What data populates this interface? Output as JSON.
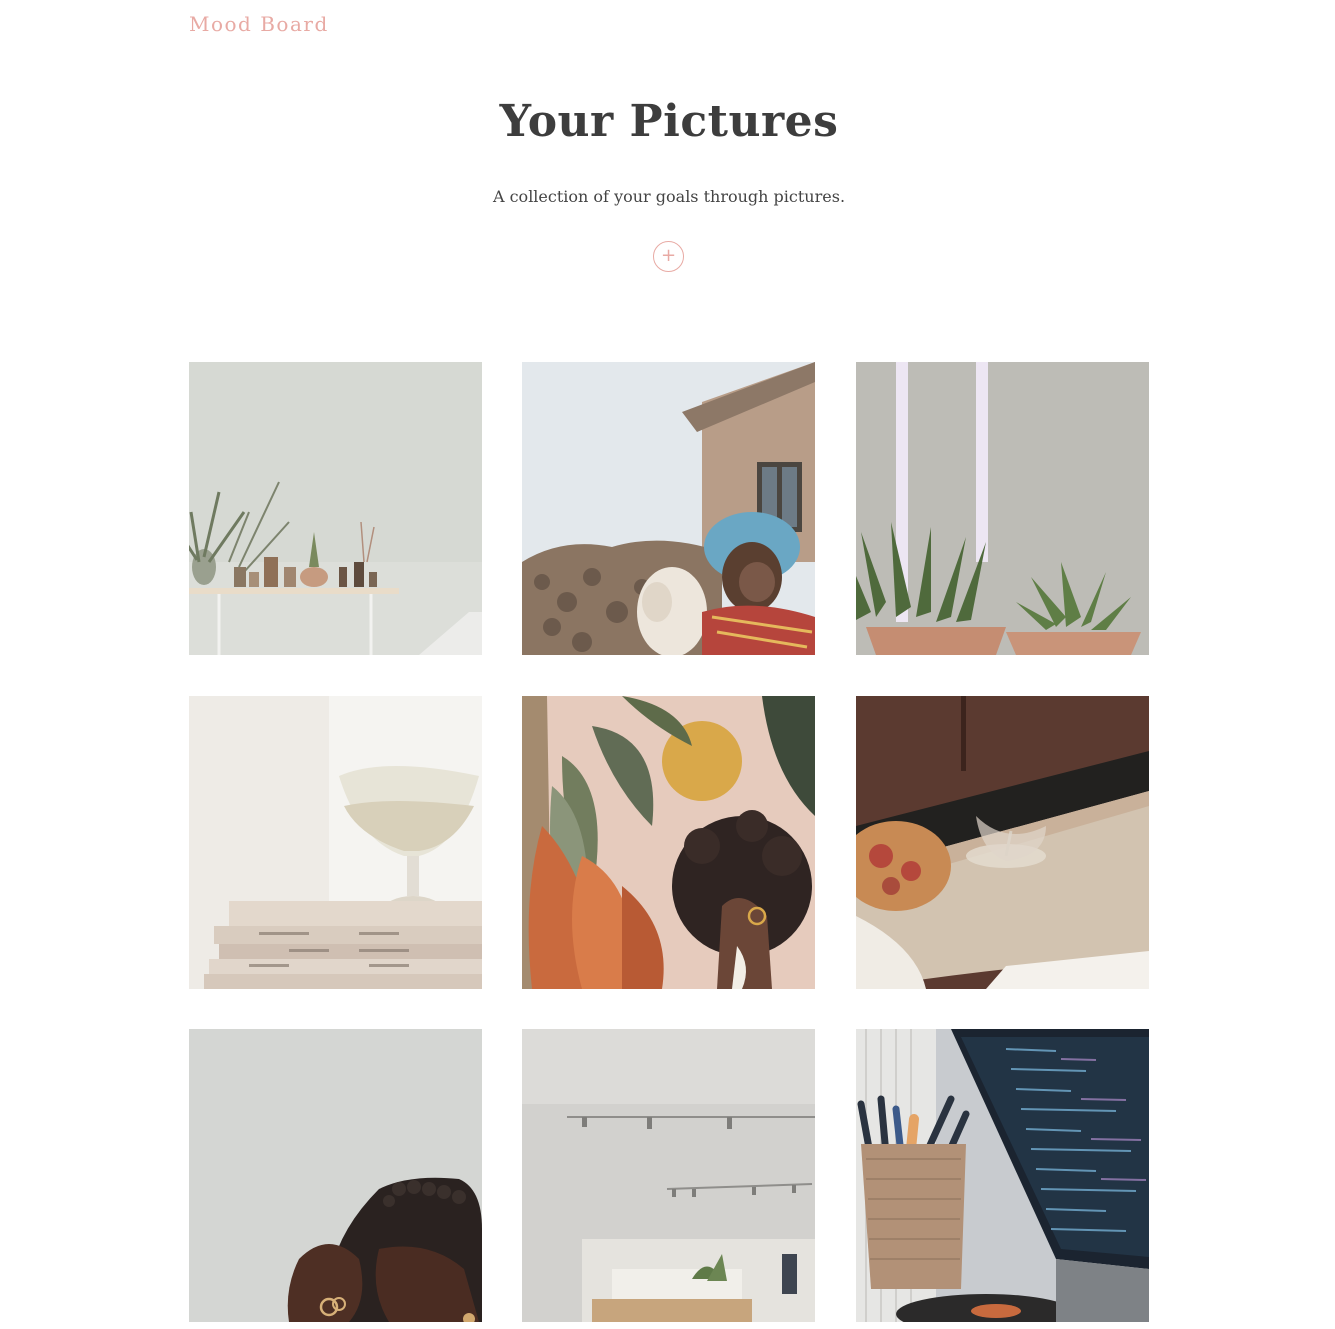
{
  "header": {
    "brand": "Mood Board"
  },
  "hero": {
    "title": "Your Pictures",
    "subtitle": "A collection of your goals through pictures.",
    "add_label": "+"
  },
  "gallery": {
    "tiles": [
      {
        "subject": "plants on wall shelf"
      },
      {
        "subject": "child with llama"
      },
      {
        "subject": "succulents with lights"
      },
      {
        "subject": "glass on stacked books"
      },
      {
        "subject": "illustrated woman with plants"
      },
      {
        "subject": "pizza and wine glass"
      },
      {
        "subject": "woman with braids"
      },
      {
        "subject": "minimal bedroom interior"
      },
      {
        "subject": "laptop with code and pens"
      }
    ]
  },
  "colors": {
    "accent": "#e8aaa4",
    "title": "#3d3d3d",
    "text": "#444444"
  }
}
